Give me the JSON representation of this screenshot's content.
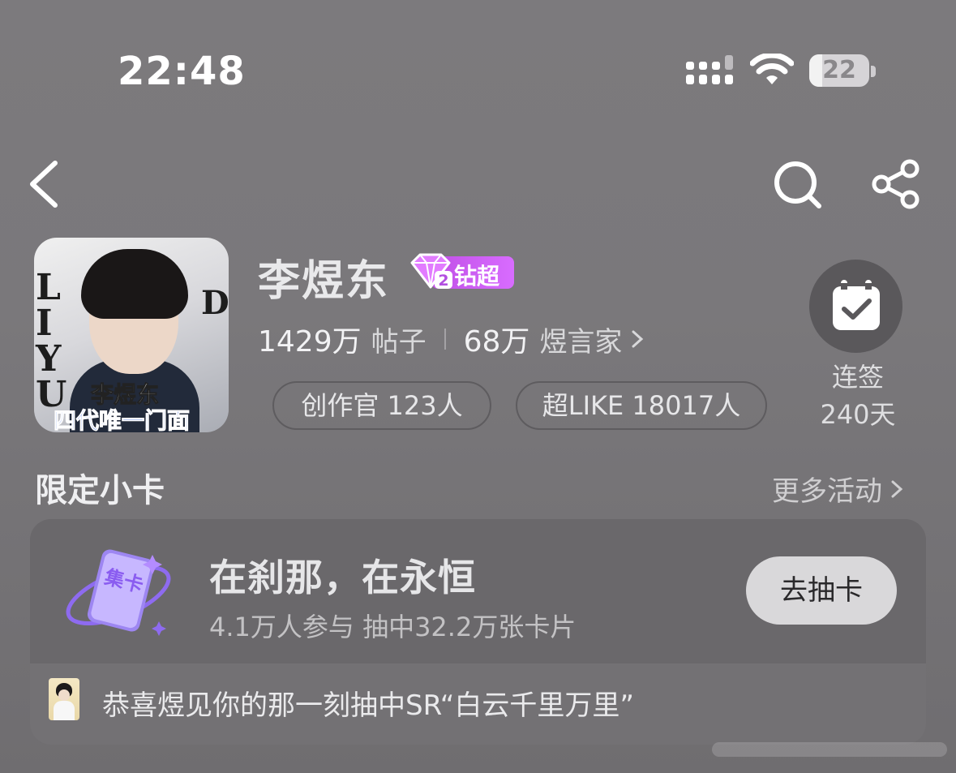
{
  "status_bar": {
    "time": "22:48",
    "battery_level": "22",
    "icons": [
      "signal-icon",
      "wifi-icon",
      "battery-icon"
    ]
  },
  "nav": {
    "icons": [
      "back-chevron-icon",
      "search-icon",
      "share-icon"
    ]
  },
  "profile": {
    "name": "李煜东",
    "badge_level": "2",
    "badge_label": "钻超",
    "avatar_text": {
      "side_letters": "LIYU",
      "right_letters": "DONG",
      "caption": "李煜东",
      "slogan": "四代唯一门面"
    },
    "posts_count": "1429万",
    "posts_label": "帖子",
    "fans_count": "68万",
    "fans_label": "煜言家",
    "pills": [
      {
        "label": "创作官 123人"
      },
      {
        "label": "超LIKE 18017人"
      }
    ]
  },
  "checkin": {
    "label": "连签",
    "days": "240天"
  },
  "section": {
    "title": "限定小卡",
    "more_label": "更多活动"
  },
  "card_activity": {
    "icon_text": "集卡",
    "title": "在刹那，在永恒",
    "subtitle": "4.1万人参与 抽中32.2万张卡片",
    "button_label": "去抽卡",
    "congrats_text": "恭喜煜见你的那一刻抽中SR“白云千里万里”"
  },
  "colors": {
    "background": "#7a787b",
    "badge_purple": "#c04fe6",
    "button_bg": "#d9d8da"
  }
}
